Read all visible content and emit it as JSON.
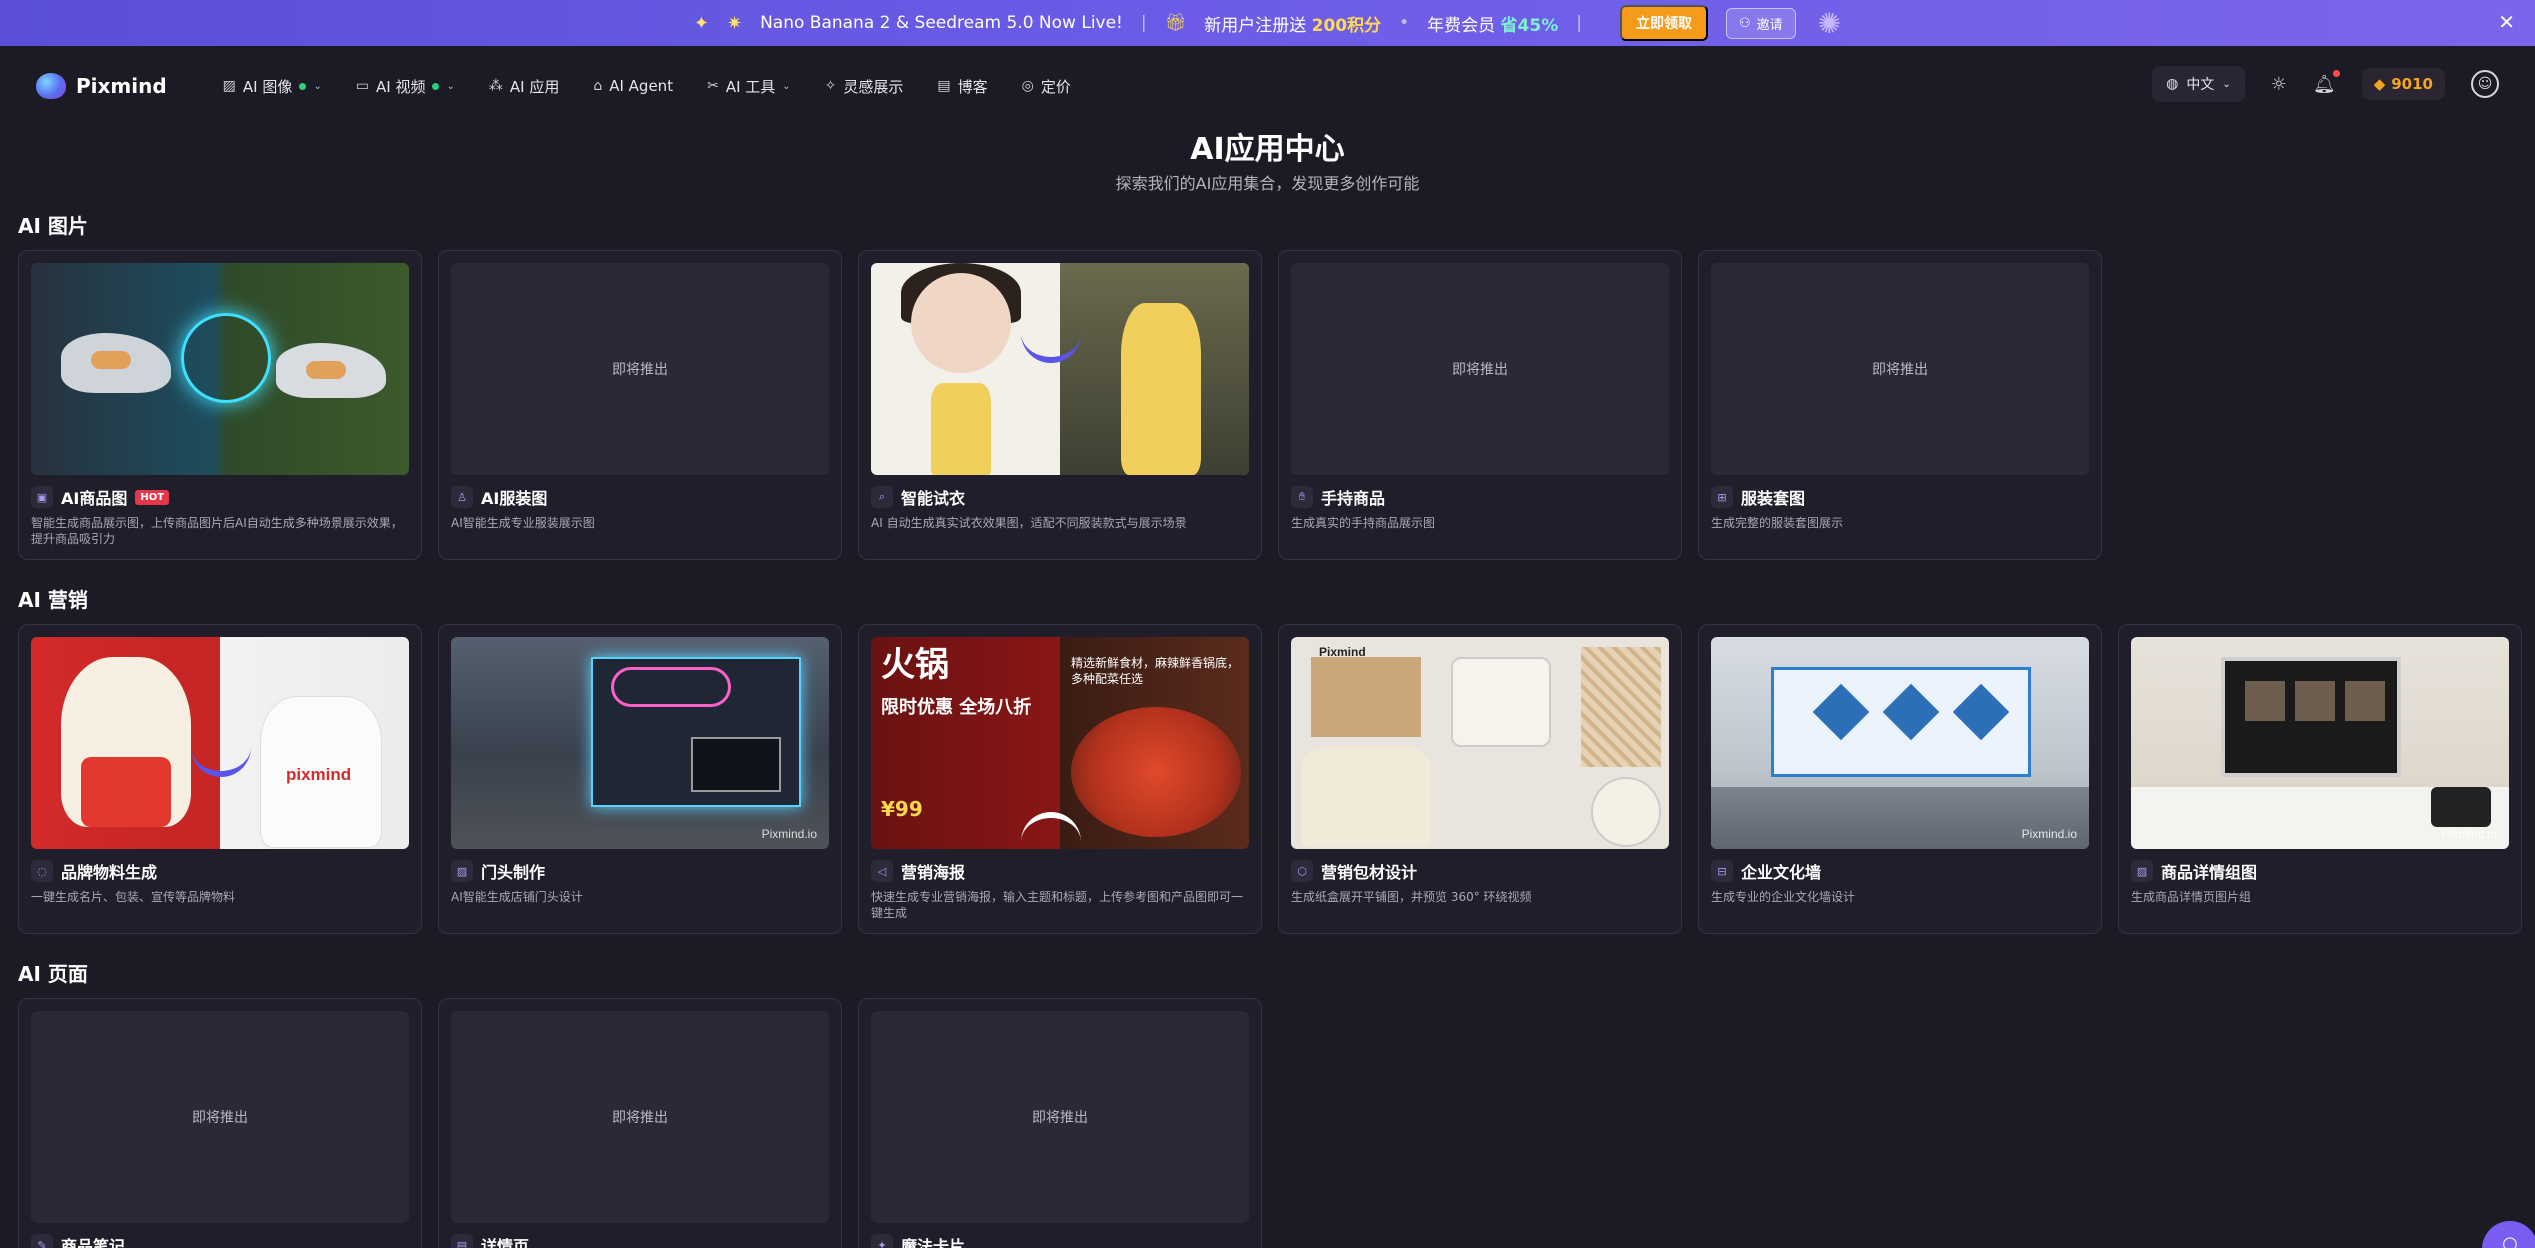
{
  "promo": {
    "headline": "Nano Banana 2 & Seedream 5.0 Now Live!",
    "signup_prefix": "新用户注册送",
    "signup_bonus": "200积分",
    "annual_prefix": "年费会员",
    "annual_save": "省45%",
    "claim_label": "立即领取",
    "invite_label": "邀请"
  },
  "nav": {
    "brand": "Pixmind",
    "items": [
      {
        "label": "AI 图像",
        "dot": true,
        "dropdown": true
      },
      {
        "label": "AI 视频",
        "dot": true,
        "dropdown": true
      },
      {
        "label": "AI 应用"
      },
      {
        "label": "AI Agent"
      },
      {
        "label": "AI 工具",
        "dropdown": true
      },
      {
        "label": "灵感展示"
      },
      {
        "label": "博客"
      },
      {
        "label": "定价"
      }
    ],
    "language": "中文",
    "credits": "9010"
  },
  "page": {
    "title": "AI应用中心",
    "subtitle": "探索我们的AI应用集合，发现更多创作可能"
  },
  "sections": [
    {
      "title": "AI 图片",
      "cards": [
        {
          "name": "AI商品图",
          "badge": "HOT",
          "desc": "智能生成商品展示图，上传商品图片后AI自动生成多种场景展示效果，提升商品吸引力",
          "art": "shoe"
        },
        {
          "name": "AI服装图",
          "desc": "AI智能生成专业服装展示图",
          "soon": "即将推出"
        },
        {
          "name": "智能试衣",
          "desc": "AI 自动生成真实试衣效果图，适配不同服装款式与展示场景",
          "art": "dress"
        },
        {
          "name": "手持商品",
          "desc": "生成真实的手持商品展示图",
          "soon": "即将推出"
        },
        {
          "name": "服装套图",
          "desc": "生成完整的服装套图展示",
          "soon": "即将推出"
        }
      ]
    },
    {
      "title": "AI 营销",
      "cards": [
        {
          "name": "品牌物料生成",
          "desc": "一键生成名片、包装、宣传等品牌物料",
          "art": "ox"
        },
        {
          "name": "门头制作",
          "desc": "AI智能生成店铺门头设计",
          "art": "store"
        },
        {
          "name": "营销海报",
          "desc": "快速生成专业营销海报，输入主题和标题，上传参考图和产品图即可一键生成",
          "art": "hotpot"
        },
        {
          "name": "营销包材设计",
          "desc": "生成纸盒展开平铺图，并预览 360° 环绕视频",
          "art": "pack"
        },
        {
          "name": "企业文化墙",
          "desc": "生成专业的企业文化墙设计",
          "art": "wall"
        },
        {
          "name": "商品详情组图",
          "desc": "生成商品详情页图片组",
          "art": "desk"
        }
      ]
    },
    {
      "title": "AI 页面",
      "cards": [
        {
          "name": "商品笔记",
          "desc": "",
          "soon": "即将推出"
        },
        {
          "name": "详情页",
          "desc": "",
          "soon": "即将推出"
        },
        {
          "name": "魔法卡片",
          "desc": "",
          "soon": "即将推出"
        }
      ]
    }
  ],
  "art_text": {
    "pixmind_wordmark": "pixmind",
    "watermark": "Pixmind.io",
    "hotpot_big": "火锅",
    "hotpot_promo": "限时优惠 全场八折",
    "hotpot_price": "¥99",
    "hotpot_right": "精选新鲜食材，麻辣鲜香锅底，多种配菜任选",
    "pack_brand": "Pixmind"
  },
  "colors": {
    "background": "#1c1b25",
    "card": "#1f1e2a",
    "accent": "#7a5cf0",
    "credits": "#f5a524",
    "hot": "#e5374a",
    "banner": "#6b5ce7"
  }
}
